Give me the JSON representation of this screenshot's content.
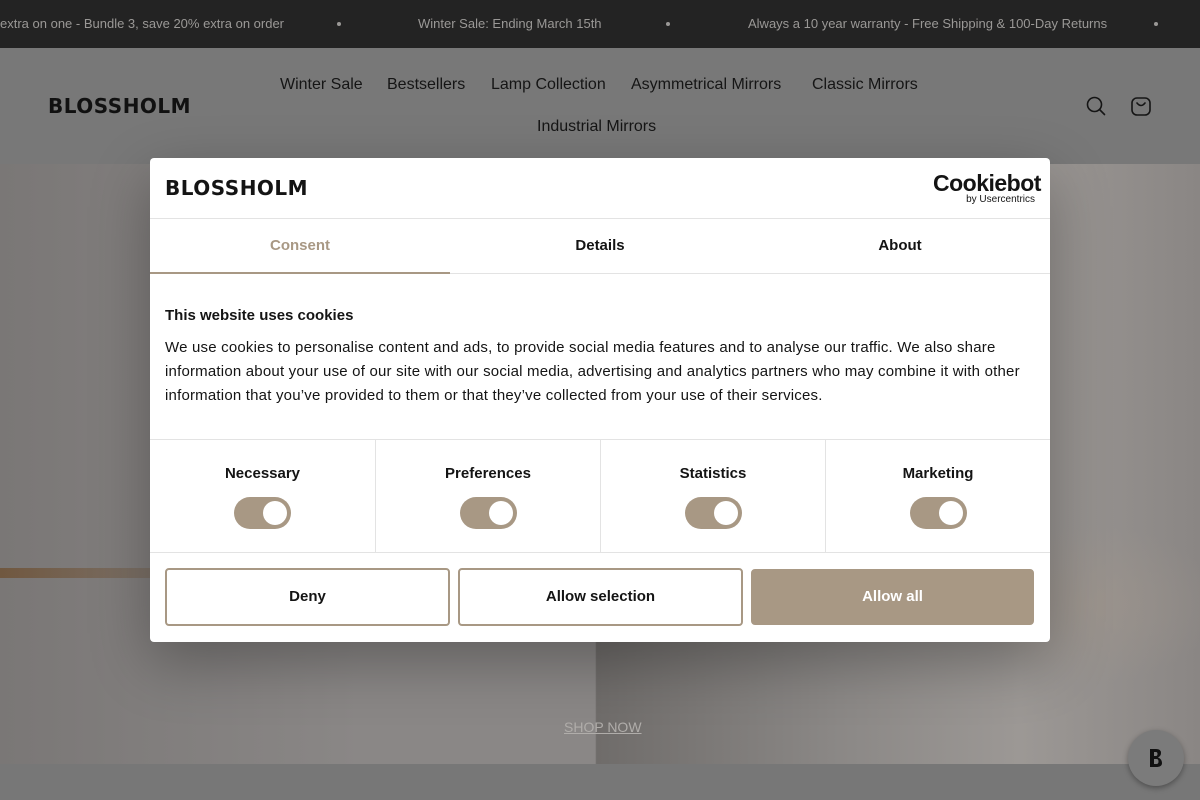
{
  "announcement": {
    "items": [
      "extra on one - Bundle 3, save 20% extra on order",
      "Winter Sale: Ending March 15th",
      "Always a 10 year warranty - Free Shipping & 100-Day Returns"
    ]
  },
  "header": {
    "logo": "BLOSSHOLM",
    "nav": [
      "Winter Sale",
      "Bestsellers",
      "Lamp Collection",
      "Asymmetrical Mirrors",
      "Classic Mirrors",
      "Industrial Mirrors"
    ],
    "icons": [
      "search-icon",
      "bag-icon"
    ]
  },
  "hero": {
    "cta": "SHOP NOW"
  },
  "cookie_dialog": {
    "logo": "BLOSSHOLM",
    "provider": {
      "name": "Cookiebot",
      "sub": "by Usercentrics"
    },
    "tabs": [
      "Consent",
      "Details",
      "About"
    ],
    "active_tab": "Consent",
    "title": "This website uses cookies",
    "body": "We use cookies to personalise content and ads, to provide social media features and to analyse our traffic. We also share information about your use of our site with our social media, advertising and analytics partners who may combine it with other information that you’ve provided to them or that they’ve collected from your use of their services.",
    "toggles": [
      {
        "label": "Necessary",
        "on": true
      },
      {
        "label": "Preferences",
        "on": true
      },
      {
        "label": "Statistics",
        "on": true
      },
      {
        "label": "Marketing",
        "on": true
      }
    ],
    "buttons": {
      "deny": "Deny",
      "allow_selection": "Allow selection",
      "allow_all": "Allow all"
    }
  },
  "colors": {
    "accent": "#a89884",
    "announce_bg": "#232323"
  }
}
